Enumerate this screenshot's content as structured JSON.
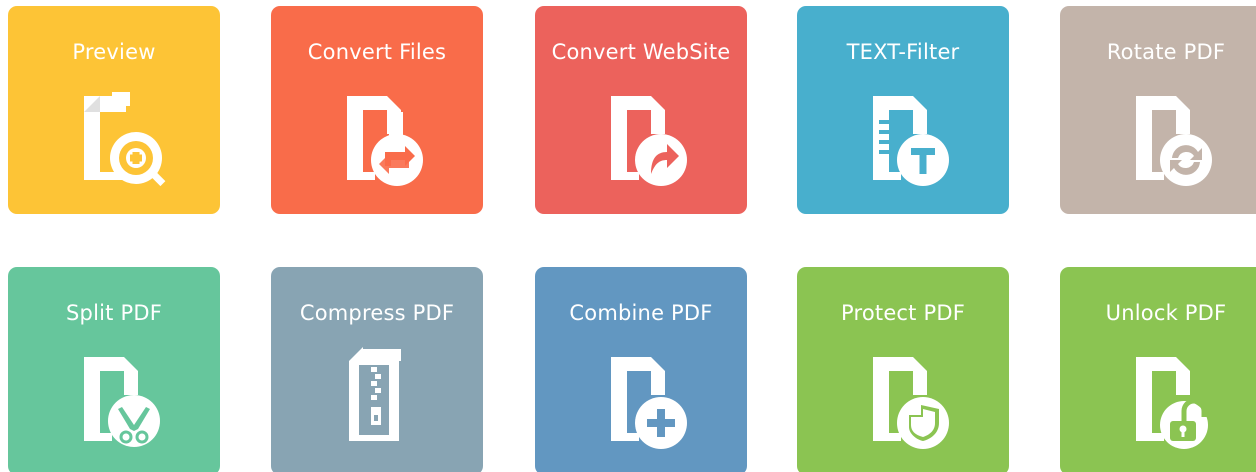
{
  "tiles": [
    {
      "label": "Preview",
      "color": "#FDC436",
      "icon": "preview-zoom-icon"
    },
    {
      "label": "Convert Files",
      "color": "#F96C4A",
      "icon": "convert-files-icon"
    },
    {
      "label": "Convert WebSite",
      "color": "#EC625C",
      "icon": "convert-website-icon"
    },
    {
      "label": "TEXT-Filter",
      "color": "#48AFCD",
      "icon": "text-filter-icon"
    },
    {
      "label": "Rotate PDF",
      "color": "#C3B4AA",
      "icon": "rotate-pdf-icon"
    },
    {
      "label": "Split PDF",
      "color": "#66C69C",
      "icon": "split-pdf-icon"
    },
    {
      "label": "Compress PDF",
      "color": "#88A4B3",
      "icon": "compress-pdf-icon"
    },
    {
      "label": "Combine PDF",
      "color": "#6297C1",
      "icon": "combine-pdf-icon"
    },
    {
      "label": "Protect PDF",
      "color": "#8BC452",
      "icon": "protect-pdf-icon"
    },
    {
      "label": "Unlock PDF",
      "color": "#8BC452",
      "icon": "unlock-pdf-icon"
    }
  ]
}
